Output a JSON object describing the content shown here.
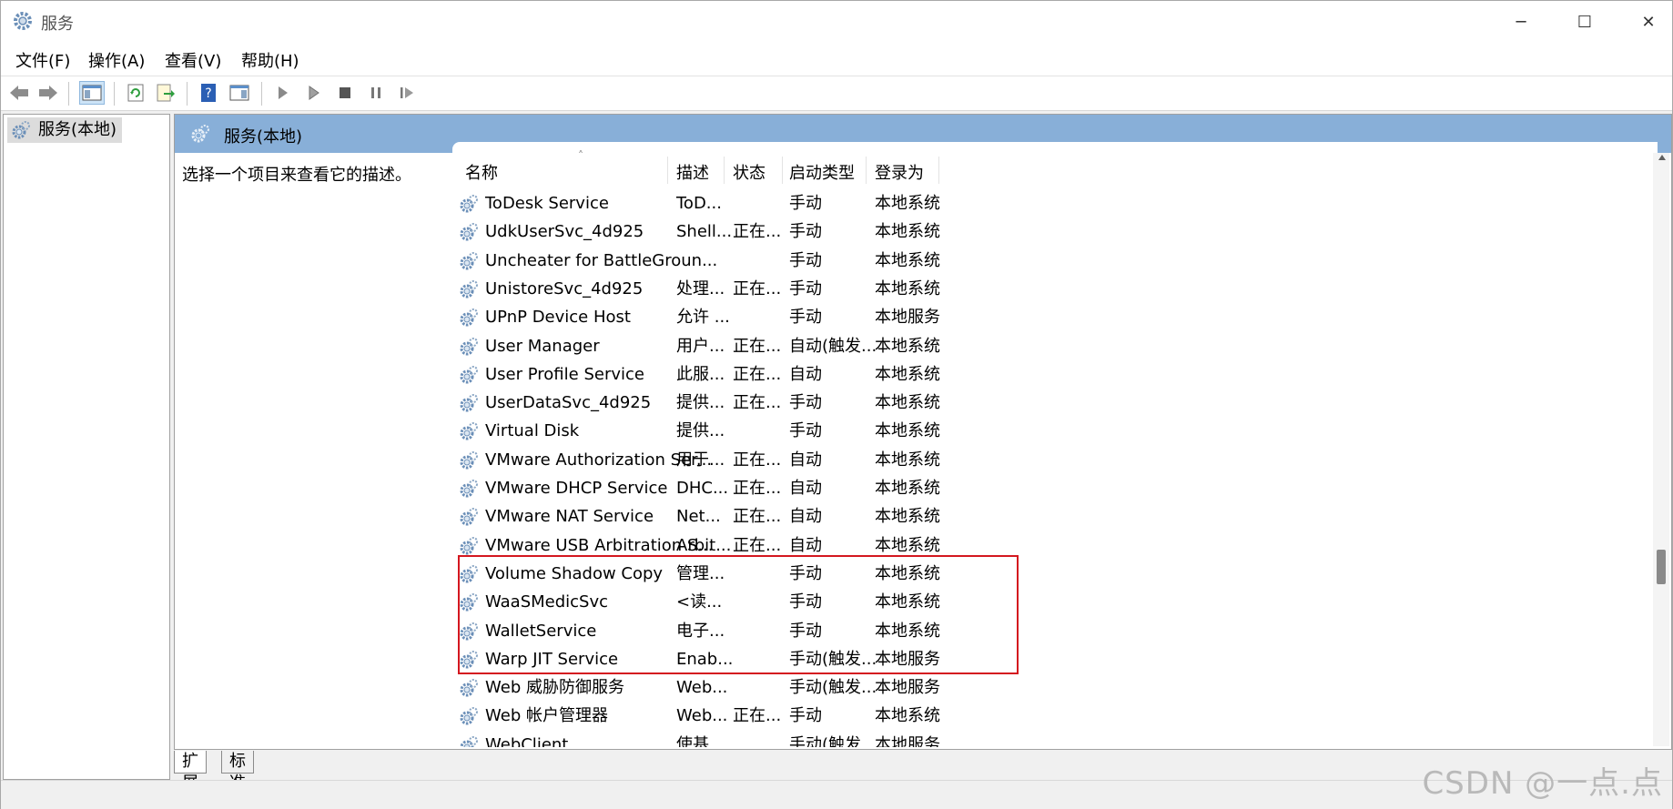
{
  "window": {
    "title": "服务",
    "controls": [
      "─",
      "☐",
      "✕"
    ]
  },
  "menu": [
    "文件(F)",
    "操作(A)",
    "查看(V)",
    "帮助(H)"
  ],
  "tree": {
    "root_label": "服务(本地)"
  },
  "panel": {
    "header_title": "服务(本地)",
    "description_prompt": "选择一个项目来查看它的描述。"
  },
  "columns": [
    "名称",
    "描述",
    "状态",
    "启动类型",
    "登录为"
  ],
  "services": [
    {
      "name": "ToDesk Service",
      "desc": "ToD...",
      "status": "",
      "startup": "手动",
      "logon": "本地系统"
    },
    {
      "name": "UdkUserSvc_4d925",
      "desc": "Shell...",
      "status": "正在...",
      "startup": "手动",
      "logon": "本地系统"
    },
    {
      "name": "Uncheater for BattleGroun...",
      "desc": "",
      "status": "",
      "startup": "手动",
      "logon": "本地系统"
    },
    {
      "name": "UnistoreSvc_4d925",
      "desc": "处理...",
      "status": "正在...",
      "startup": "手动",
      "logon": "本地系统"
    },
    {
      "name": "UPnP Device Host",
      "desc": "允许 ...",
      "status": "",
      "startup": "手动",
      "logon": "本地服务"
    },
    {
      "name": "User Manager",
      "desc": "用户...",
      "status": "正在...",
      "startup": "自动(触发...",
      "logon": "本地系统"
    },
    {
      "name": "User Profile Service",
      "desc": "此服...",
      "status": "正在...",
      "startup": "自动",
      "logon": "本地系统"
    },
    {
      "name": "UserDataSvc_4d925",
      "desc": "提供...",
      "status": "正在...",
      "startup": "手动",
      "logon": "本地系统"
    },
    {
      "name": "Virtual Disk",
      "desc": "提供...",
      "status": "",
      "startup": "手动",
      "logon": "本地系统"
    },
    {
      "name": "VMware Authorization Ser...",
      "desc": "用于...",
      "status": "正在...",
      "startup": "自动",
      "logon": "本地系统"
    },
    {
      "name": "VMware DHCP Service",
      "desc": "DHC...",
      "status": "正在...",
      "startup": "自动",
      "logon": "本地系统"
    },
    {
      "name": "VMware NAT Service",
      "desc": "Net...",
      "status": "正在...",
      "startup": "自动",
      "logon": "本地系统"
    },
    {
      "name": "VMware USB Arbitration S...",
      "desc": "Arbit...",
      "status": "正在...",
      "startup": "自动",
      "logon": "本地系统"
    },
    {
      "name": "Volume Shadow Copy",
      "desc": "管理...",
      "status": "",
      "startup": "手动",
      "logon": "本地系统"
    },
    {
      "name": "WaaSMedicSvc",
      "desc": "<读...",
      "status": "",
      "startup": "手动",
      "logon": "本地系统"
    },
    {
      "name": "WalletService",
      "desc": "电子...",
      "status": "",
      "startup": "手动",
      "logon": "本地系统"
    },
    {
      "name": "Warp JIT Service",
      "desc": "Enab...",
      "status": "",
      "startup": "手动(触发...",
      "logon": "本地服务"
    },
    {
      "name": "Web 威胁防御服务",
      "desc": "Web...",
      "status": "",
      "startup": "手动(触发...",
      "logon": "本地服务"
    },
    {
      "name": "Web 帐户管理器",
      "desc": "Web...",
      "status": "正在...",
      "startup": "手动",
      "logon": "本地系统"
    },
    {
      "name": "WebClient",
      "desc": "使基...",
      "status": "",
      "startup": "手动(触发...",
      "logon": "本地服务"
    }
  ],
  "tabs": [
    "扩展",
    "标准"
  ],
  "watermark": "CSDN @一点.点",
  "colors": {
    "header_blue": "#88afd8",
    "highlight_red": "#d4171f"
  }
}
